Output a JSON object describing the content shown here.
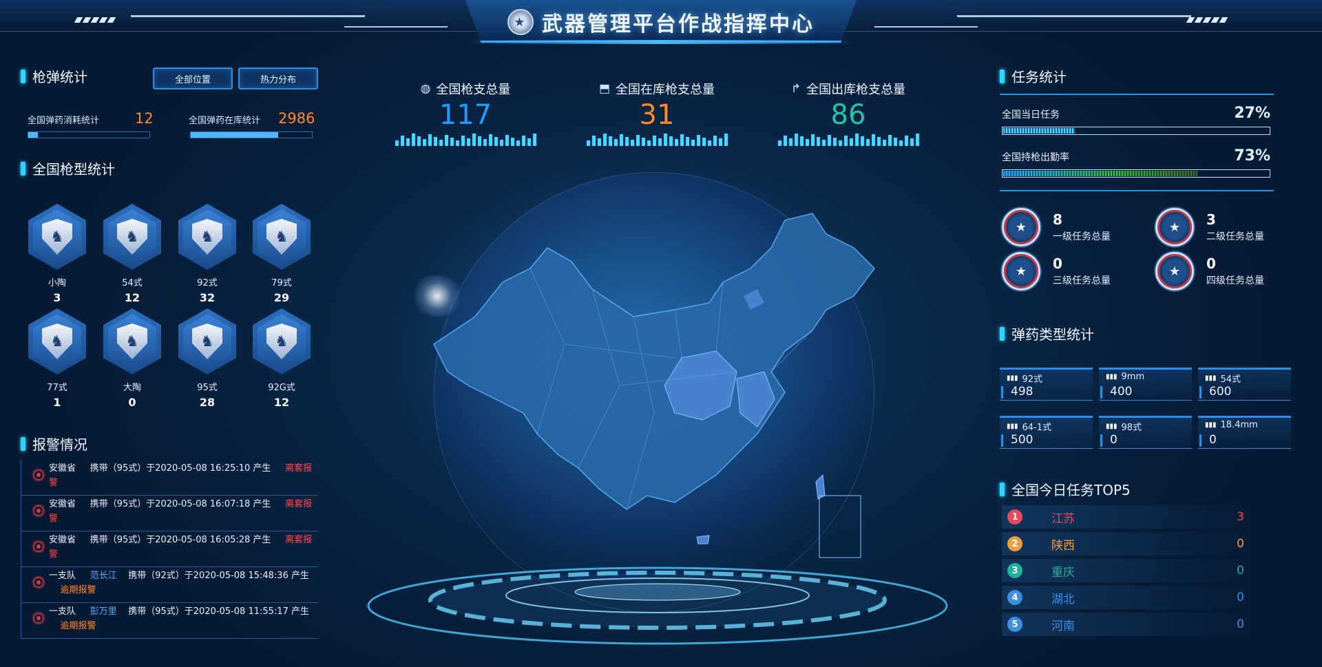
{
  "header": {
    "title": "武器管理平台作战指挥中心",
    "emblem_icon": "police-emblem-icon"
  },
  "ammo_stats": {
    "title": "枪弹统计",
    "btn_all_positions": "全部位置",
    "btn_heat_map": "热力分布",
    "consumed_label": "全国弹药消耗统计",
    "consumed_value": "12",
    "consumed_progress": 0.08,
    "in_stock_label": "全国弹药在库统计",
    "in_stock_value": "2986",
    "in_stock_progress": 0.72
  },
  "gun_types": {
    "title": "全国枪型统计",
    "items": [
      {
        "name": "小陶",
        "count": "3"
      },
      {
        "name": "54式",
        "count": "12"
      },
      {
        "name": "92式",
        "count": "32"
      },
      {
        "name": "79式",
        "count": "29"
      },
      {
        "name": "77式",
        "count": "1"
      },
      {
        "name": "大陶",
        "count": "0"
      },
      {
        "name": "95式",
        "count": "28"
      },
      {
        "name": "92G式",
        "count": "12"
      }
    ]
  },
  "alarms": {
    "title": "报警情况",
    "items": [
      {
        "place": "安徽省",
        "text": "携带（95式）于2020-05-08 16:25:10 产生",
        "status": "离套报警",
        "status_color": "red"
      },
      {
        "place": "安徽省",
        "text": "携带（95式）于2020-05-08 16:07:18 产生",
        "status": "离套报警",
        "status_color": "red"
      },
      {
        "place": "安徽省",
        "text": "携带（95式）于2020-05-08 16:05:28 产生",
        "status": "离套报警",
        "status_color": "red"
      },
      {
        "place": "一支队",
        "person": "范长江",
        "text": "携带（92式）于2020-05-08 15:48:36 产生",
        "status": "逾期报警",
        "status_color": "orange"
      },
      {
        "place": "一支队",
        "person": "彭万里",
        "text": "携带（95式）于2020-05-08 11:55:17 产生",
        "status": "逾期报警",
        "status_color": "orange"
      }
    ]
  },
  "kpis": [
    {
      "label": "全国枪支总量",
      "value": "117",
      "color": "#1f9dff",
      "icon": "globe-icon"
    },
    {
      "label": "全国在库枪支总量",
      "value": "31",
      "color": "#ff8a2a",
      "icon": "warehouse-icon"
    },
    {
      "label": "全国出库枪支总量",
      "value": "86",
      "color": "#24c3a6",
      "icon": "export-icon"
    }
  ],
  "tasks": {
    "title": "任务统计",
    "daily_label": "全国当日任务",
    "daily_pct": "27%",
    "daily_fraction": 0.27,
    "armed_label": "全国持枪出勤率",
    "armed_pct": "73%",
    "armed_fraction": 0.73,
    "levels": [
      {
        "count": "8",
        "label": "一级任务总量"
      },
      {
        "count": "3",
        "label": "二级任务总量"
      },
      {
        "count": "0",
        "label": "三级任务总量"
      },
      {
        "count": "0",
        "label": "四级任务总量"
      }
    ]
  },
  "ammo_types": {
    "title": "弹药类型统计",
    "items": [
      {
        "name": "92式",
        "value": "498"
      },
      {
        "name": "9mm",
        "value": "400"
      },
      {
        "name": "54式",
        "value": "600"
      },
      {
        "name": "64-1式",
        "value": "500"
      },
      {
        "name": "98式",
        "value": "0"
      },
      {
        "name": "18.4mm",
        "value": "0"
      }
    ]
  },
  "top5": {
    "title": "全国今日任务TOP5",
    "items": [
      {
        "rank": "1",
        "province": "江苏",
        "count": "3",
        "color": "#e84a5a"
      },
      {
        "rank": "2",
        "province": "陕西",
        "count": "0",
        "color": "#e8a040"
      },
      {
        "rank": "3",
        "province": "重庆",
        "count": "0",
        "color": "#22b09a"
      },
      {
        "rank": "4",
        "province": "湖北",
        "count": "0",
        "color": "#3c8fe0"
      },
      {
        "rank": "5",
        "province": "河南",
        "count": "0",
        "color": "#3c8fe0"
      }
    ]
  },
  "colors": {
    "accent": "#35d3ff",
    "orange": "#ff8a2a",
    "panel_border": "#2d8fe0"
  }
}
